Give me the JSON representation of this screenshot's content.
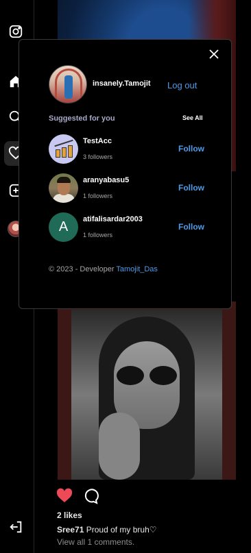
{
  "profile": {
    "username": "insanely.Tamojit",
    "logout_label": "Log out"
  },
  "suggestions": {
    "heading": "Suggested for you",
    "see_all": "See All",
    "items": [
      {
        "username": "TestAcc",
        "followers": "3 followers",
        "follow_label": "Follow"
      },
      {
        "username": "aranyabasu5",
        "followers": "1 followers",
        "follow_label": "Follow"
      },
      {
        "username": "atifalisardar2003",
        "followers": "1 followers",
        "follow_label": "Follow",
        "avatar_letter": "A"
      }
    ]
  },
  "footer": {
    "prefix": "© 2023 - Developer ",
    "developer": "Tamojit_Das"
  },
  "post": {
    "likes": "2 likes",
    "caption_user": "Sree71",
    "caption_text": "Proud of my bruh♡",
    "comments_link": "View all 1 comments."
  },
  "colors": {
    "accent": "#4f9be8",
    "like": "#ed4956",
    "background": "#000000"
  },
  "icons": [
    "instagram-icon",
    "home-icon",
    "search-icon",
    "heart-icon",
    "create-icon",
    "logout-icon",
    "close-icon",
    "comment-icon"
  ]
}
